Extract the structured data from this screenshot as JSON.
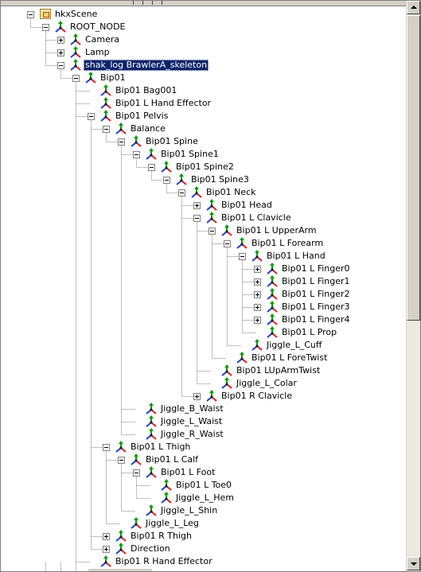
{
  "tree": [
    {
      "label": "hkxScene",
      "depth": 0,
      "expander": "minus",
      "icon": "scene-icon"
    },
    {
      "label": "ROOT_NODE",
      "depth": 1,
      "expander": "minus",
      "icon": "bone-icon"
    },
    {
      "label": "Camera",
      "depth": 2,
      "expander": "plus",
      "icon": "bone-icon"
    },
    {
      "label": "Lamp",
      "depth": 2,
      "expander": "plus",
      "icon": "bone-icon"
    },
    {
      "label": "shak_log BrawlerA_skeleton",
      "depth": 2,
      "expander": "minus",
      "icon": "bone-icon",
      "selected": true
    },
    {
      "label": "Bip01",
      "depth": 3,
      "expander": "minus",
      "icon": "bone-icon"
    },
    {
      "label": "Bip01 Bag001",
      "depth": 4,
      "expander": "none",
      "icon": "bone-icon"
    },
    {
      "label": "Bip01 L Hand Effector",
      "depth": 4,
      "expander": "none",
      "icon": "bone-icon"
    },
    {
      "label": "Bip01 Pelvis",
      "depth": 4,
      "expander": "minus",
      "icon": "bone-icon"
    },
    {
      "label": "Balance",
      "depth": 5,
      "expander": "minus",
      "icon": "bone-icon"
    },
    {
      "label": "Bip01 Spine",
      "depth": 6,
      "expander": "minus",
      "icon": "bone-icon"
    },
    {
      "label": "Bip01 Spine1",
      "depth": 7,
      "expander": "minus",
      "icon": "bone-icon"
    },
    {
      "label": "Bip01 Spine2",
      "depth": 8,
      "expander": "minus",
      "icon": "bone-icon"
    },
    {
      "label": "Bip01 Spine3",
      "depth": 9,
      "expander": "minus",
      "icon": "bone-icon"
    },
    {
      "label": "Bip01 Neck",
      "depth": 10,
      "expander": "minus",
      "icon": "bone-icon"
    },
    {
      "label": "Bip01 Head",
      "depth": 11,
      "expander": "plus",
      "icon": "bone-icon"
    },
    {
      "label": "Bip01 L Clavicle",
      "depth": 11,
      "expander": "minus",
      "icon": "bone-icon"
    },
    {
      "label": "Bip01 L UpperArm",
      "depth": 12,
      "expander": "minus",
      "icon": "bone-icon"
    },
    {
      "label": "Bip01 L Forearm",
      "depth": 13,
      "expander": "minus",
      "icon": "bone-icon"
    },
    {
      "label": "Bip01 L Hand",
      "depth": 14,
      "expander": "minus",
      "icon": "bone-icon"
    },
    {
      "label": "Bip01 L Finger0",
      "depth": 15,
      "expander": "plus",
      "icon": "bone-icon"
    },
    {
      "label": "Bip01 L Finger1",
      "depth": 15,
      "expander": "plus",
      "icon": "bone-icon"
    },
    {
      "label": "Bip01 L Finger2",
      "depth": 15,
      "expander": "plus",
      "icon": "bone-icon"
    },
    {
      "label": "Bip01 L Finger3",
      "depth": 15,
      "expander": "plus",
      "icon": "bone-icon"
    },
    {
      "label": "Bip01 L Finger4",
      "depth": 15,
      "expander": "plus",
      "icon": "bone-icon"
    },
    {
      "label": "Bip01 L Prop",
      "depth": 15,
      "expander": "none",
      "icon": "bone-icon"
    },
    {
      "label": "Jiggle_L_Cuff",
      "depth": 14,
      "expander": "none",
      "icon": "bone-icon"
    },
    {
      "label": "Bip01 L ForeTwist",
      "depth": 13,
      "expander": "none",
      "icon": "bone-icon"
    },
    {
      "label": "Bip01 LUpArmTwist",
      "depth": 12,
      "expander": "none",
      "icon": "bone-icon"
    },
    {
      "label": "Jiggle_L_Colar",
      "depth": 12,
      "expander": "none",
      "icon": "bone-icon"
    },
    {
      "label": "Bip01 R Clavicle",
      "depth": 11,
      "expander": "plus",
      "icon": "bone-icon"
    },
    {
      "label": "Jiggle_B_Waist",
      "depth": 7,
      "expander": "none",
      "icon": "bone-icon"
    },
    {
      "label": "Jiggle_L_Waist",
      "depth": 7,
      "expander": "none",
      "icon": "bone-icon"
    },
    {
      "label": "Jiggle_R_Waist",
      "depth": 7,
      "expander": "none",
      "icon": "bone-icon"
    },
    {
      "label": "Bip01 L Thigh",
      "depth": 5,
      "expander": "minus",
      "icon": "bone-icon"
    },
    {
      "label": "Bip01 L Calf",
      "depth": 6,
      "expander": "minus",
      "icon": "bone-icon"
    },
    {
      "label": "Bip01 L Foot",
      "depth": 7,
      "expander": "minus",
      "icon": "bone-icon"
    },
    {
      "label": "Bip01 L Toe0",
      "depth": 8,
      "expander": "none",
      "icon": "bone-icon"
    },
    {
      "label": "Jiggle_L_Hem",
      "depth": 8,
      "expander": "none",
      "icon": "bone-icon"
    },
    {
      "label": "Jiggle_L_Shin",
      "depth": 7,
      "expander": "none",
      "icon": "bone-icon"
    },
    {
      "label": "Jiggle_L_Leg",
      "depth": 6,
      "expander": "none",
      "icon": "bone-icon"
    },
    {
      "label": "Bip01 R Thigh",
      "depth": 5,
      "expander": "plus",
      "icon": "bone-icon"
    },
    {
      "label": "Direction",
      "depth": 5,
      "expander": "plus",
      "icon": "bone-icon"
    },
    {
      "label": "Bip01 R Hand Effector",
      "depth": 4,
      "expander": "none",
      "icon": "bone-icon"
    }
  ],
  "colors": {
    "selection_bg": "#0a246a",
    "selection_fg": "#ffffff",
    "tree_line": "#808080",
    "bone_green": "#0a9a0a",
    "bone_red": "#d81e1e",
    "bone_blue": "#1e3cd8"
  }
}
